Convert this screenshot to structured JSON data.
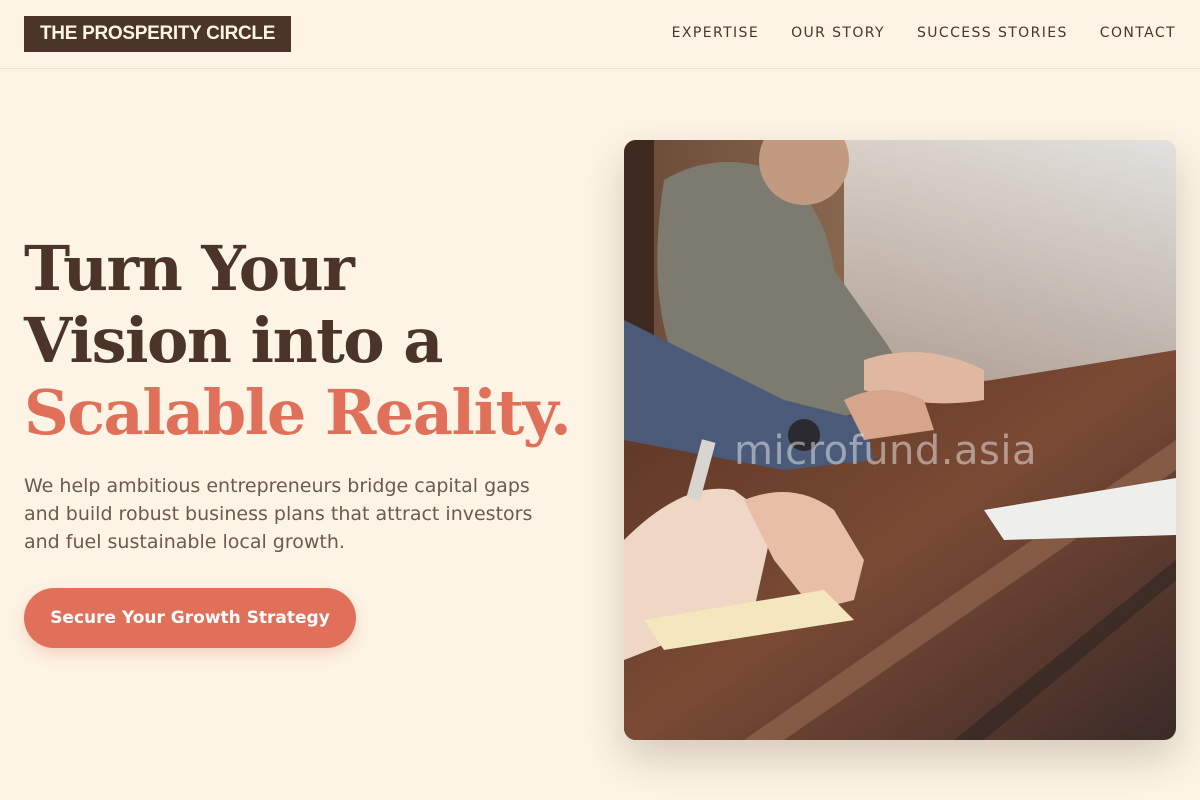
{
  "header": {
    "logo": "THE PROSPERITY CIRCLE",
    "nav": [
      "EXPERTISE",
      "OUR STORY",
      "SUCCESS STORIES",
      "CONTACT"
    ]
  },
  "hero": {
    "title_line1": "Turn Your",
    "title_line2": "Vision into a",
    "title_accent": "Scalable Reality.",
    "subtitle": "We help ambitious entrepreneurs bridge capital gaps and build robust business plans that attract investors and fuel sustainable local growth.",
    "cta_label": "Secure Your Growth Strategy"
  },
  "image": {
    "alt": "Business meeting at wooden table",
    "watermark": "microfund.asia"
  },
  "colors": {
    "background": "#fdf4e5",
    "primary_dark": "#4a3528",
    "accent": "#e0705a"
  }
}
